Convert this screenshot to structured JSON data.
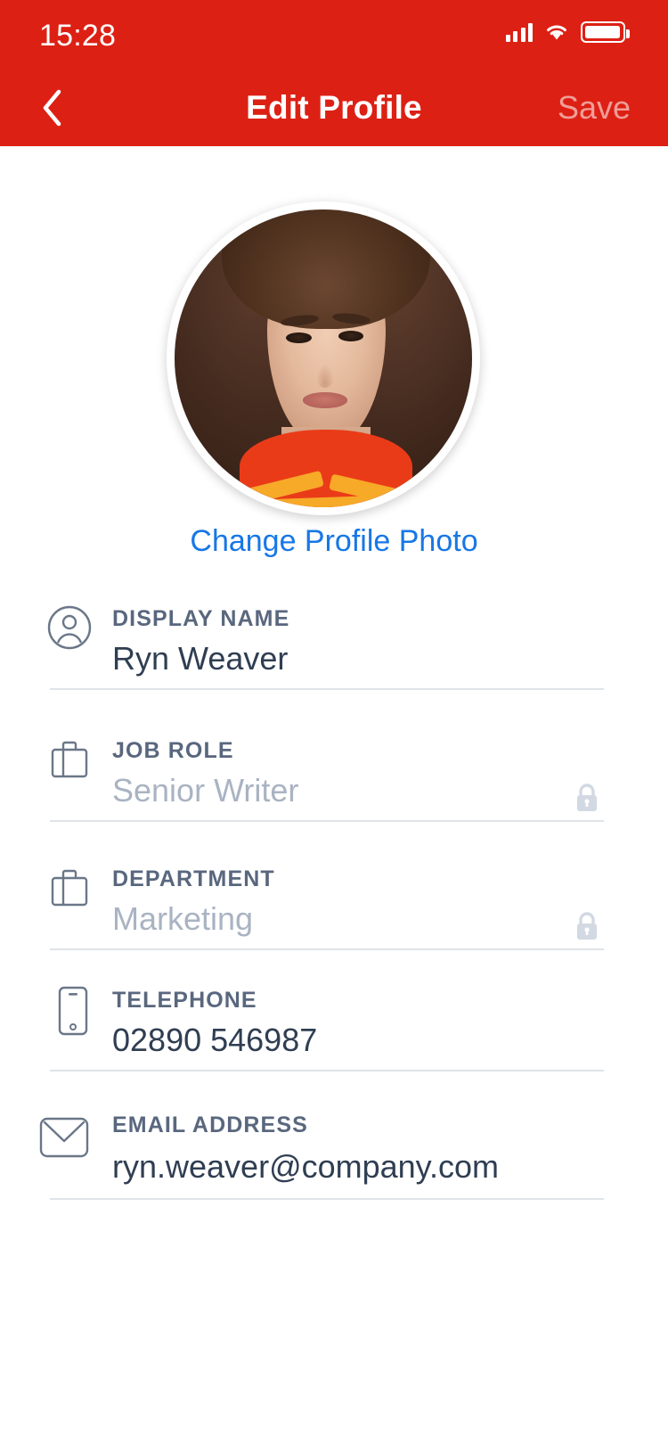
{
  "status_bar": {
    "time": "15:28",
    "signal_icon": "cellular-signal-icon",
    "signal_bars": 4,
    "wifi_icon": "wifi-icon",
    "battery_icon": "battery-full-icon",
    "battery_level": 100
  },
  "nav": {
    "back_icon": "chevron-left-icon",
    "title": "Edit Profile",
    "save_label": "Save",
    "save_enabled": false
  },
  "avatar": {
    "alt": "profile-photo",
    "change_photo_label": "Change Profile Photo"
  },
  "fields": [
    {
      "icon": "person-icon",
      "label": "DISPLAY NAME",
      "value": "Ryn Weaver",
      "locked": false
    },
    {
      "icon": "briefcase-icon",
      "label": "JOB ROLE",
      "value": "Senior Writer",
      "locked": true,
      "lock_icon": "lock-icon"
    },
    {
      "icon": "briefcase-icon",
      "label": "DEPARTMENT",
      "value": "Marketing",
      "locked": true,
      "lock_icon": "lock-icon"
    },
    {
      "icon": "phone-icon",
      "label": "TELEPHONE",
      "value": "02890 546987",
      "locked": false
    },
    {
      "icon": "envelope-icon",
      "label": "EMAIL ADDRESS",
      "value": "ryn.weaver@company.com",
      "locked": false
    }
  ],
  "colors": {
    "header_red": "#dd2014",
    "link_blue": "#1877e6",
    "label_slate": "#59677e",
    "value_dark": "#2f3e52",
    "value_locked": "#a9b3c2",
    "divider": "#dfe3e8"
  }
}
